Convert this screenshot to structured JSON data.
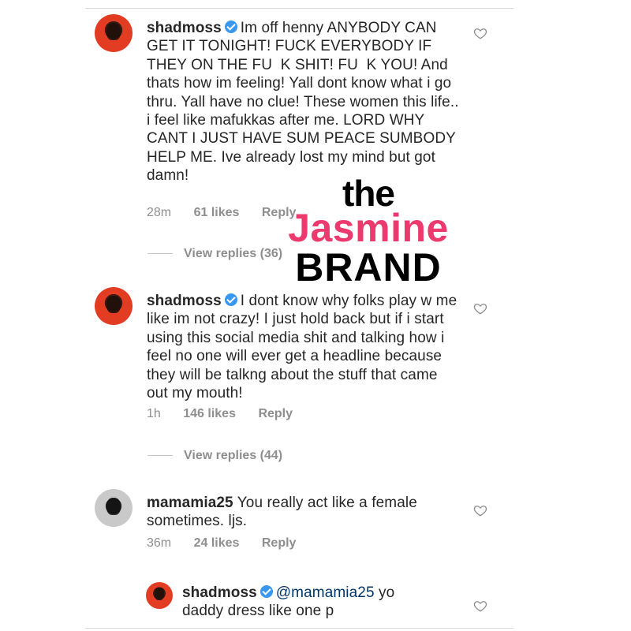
{
  "comments": [
    {
      "username": "shadmoss",
      "text": "Im off henny ANYBODY CAN GET IT TONIGHT! FUCK EVERYBODY IF THEY ON THE FU  K SHIT! FU  K YOU! And thats how im feeling! Yall dont know what i go thru. Yall have no clue! These women this life.. i feel like mafukkas after me. LORD WHY CANT I JUST HAVE SUM PEACE SUMBODY HELP ME. Ive already lost my mind but got damn!",
      "time": "28m",
      "likes": "61 likes",
      "reply": "Reply",
      "view_replies": "View replies (36)"
    },
    {
      "username": "shadmoss",
      "text": "I dont know why folks play w me like im not crazy! I just hold back but if i start using this social media shit and talking how i feel no one will ever get a headline because they will be talkng about the stuff that came out my mouth!",
      "time": "1h",
      "likes": "146 likes",
      "reply": "Reply",
      "view_replies": "View replies (44)"
    },
    {
      "username": "mamamia25",
      "text": "You really act like a female sometimes. ljs.",
      "time": "36m",
      "likes": "24 likes",
      "reply": "Reply"
    },
    {
      "username": "shadmoss",
      "mention": "@mamamia25",
      "text": "yo daddy dress like one p"
    }
  ],
  "watermark": {
    "line1": "the",
    "line2": "Jasmine",
    "line3": "BRAND"
  }
}
